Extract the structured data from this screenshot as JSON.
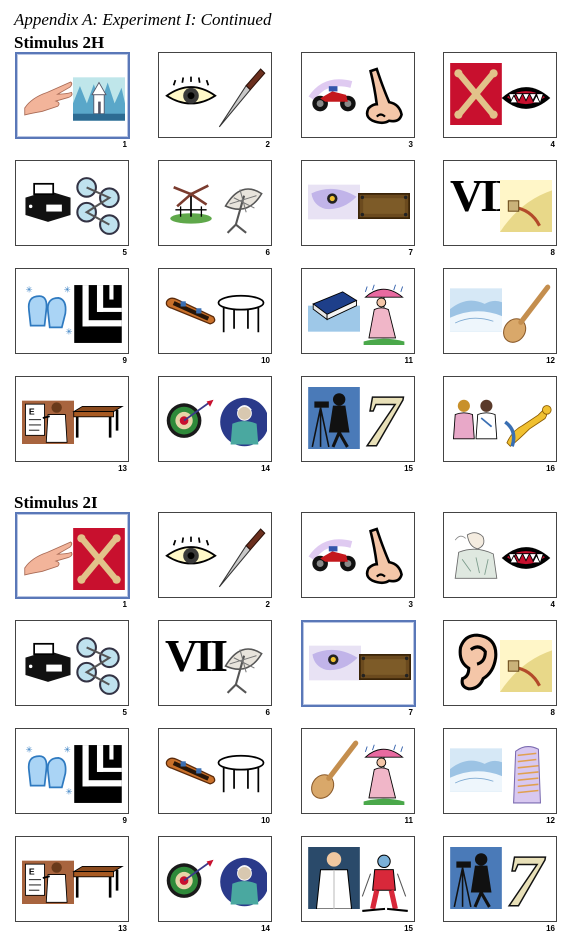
{
  "header": "Appendix A: Experiment I: Continued",
  "sections": [
    {
      "title": "Stimulus 2H",
      "items": [
        {
          "n": "1",
          "left": "hand",
          "right": "church",
          "hl": true
        },
        {
          "n": "2",
          "left": "eye",
          "right": "knife"
        },
        {
          "n": "3",
          "left": "motorcycle",
          "right": "nose"
        },
        {
          "n": "4",
          "left": "bones",
          "right": "fangs"
        },
        {
          "n": "5",
          "left": "fax",
          "right": "bikes"
        },
        {
          "n": "6",
          "left": "windmill",
          "right": "satellite"
        },
        {
          "n": "7",
          "left": "camera",
          "right": "board"
        },
        {
          "n": "8",
          "left": "roman",
          "right": "plug"
        },
        {
          "n": "9",
          "left": "mittens",
          "right": "blockL"
        },
        {
          "n": "10",
          "left": "skateboard",
          "right": "table"
        },
        {
          "n": "11",
          "left": "book",
          "right": "rainlady"
        },
        {
          "n": "12",
          "left": "snowhill",
          "right": "spoon"
        },
        {
          "n": "13",
          "left": "doctor",
          "right": "desk"
        },
        {
          "n": "14",
          "left": "dartboard",
          "right": "surgeon"
        },
        {
          "n": "15",
          "left": "photographer",
          "right": "seven"
        },
        {
          "n": "16",
          "left": "nurses",
          "right": "trumpet"
        }
      ]
    },
    {
      "title": "Stimulus 2I",
      "items": [
        {
          "n": "1",
          "left": "hand",
          "right": "bones",
          "hl": true
        },
        {
          "n": "2",
          "left": "eye",
          "right": "knife"
        },
        {
          "n": "3",
          "left": "motorcycle",
          "right": "nose"
        },
        {
          "n": "4",
          "left": "sketch",
          "right": "fangs"
        },
        {
          "n": "5",
          "left": "fax",
          "right": "bikes"
        },
        {
          "n": "6",
          "left": "roman",
          "right": "satellite"
        },
        {
          "n": "7",
          "left": "camera",
          "right": "board",
          "hl": true
        },
        {
          "n": "8",
          "left": "ear",
          "right": "plug"
        },
        {
          "n": "9",
          "left": "mittens",
          "right": "blockL"
        },
        {
          "n": "10",
          "left": "skateboard",
          "right": "table"
        },
        {
          "n": "11",
          "left": "spoon",
          "right": "rainlady"
        },
        {
          "n": "12",
          "left": "snowhill",
          "right": "building"
        },
        {
          "n": "13",
          "left": "doctor",
          "right": "desk"
        },
        {
          "n": "14",
          "left": "dartboard",
          "right": "surgeon"
        },
        {
          "n": "15",
          "left": "labcoat",
          "right": "skier"
        },
        {
          "n": "16",
          "left": "photographer",
          "right": "seven"
        }
      ]
    }
  ],
  "roman_text": "VII",
  "seven_text": "7",
  "eye_chart_text": "E"
}
